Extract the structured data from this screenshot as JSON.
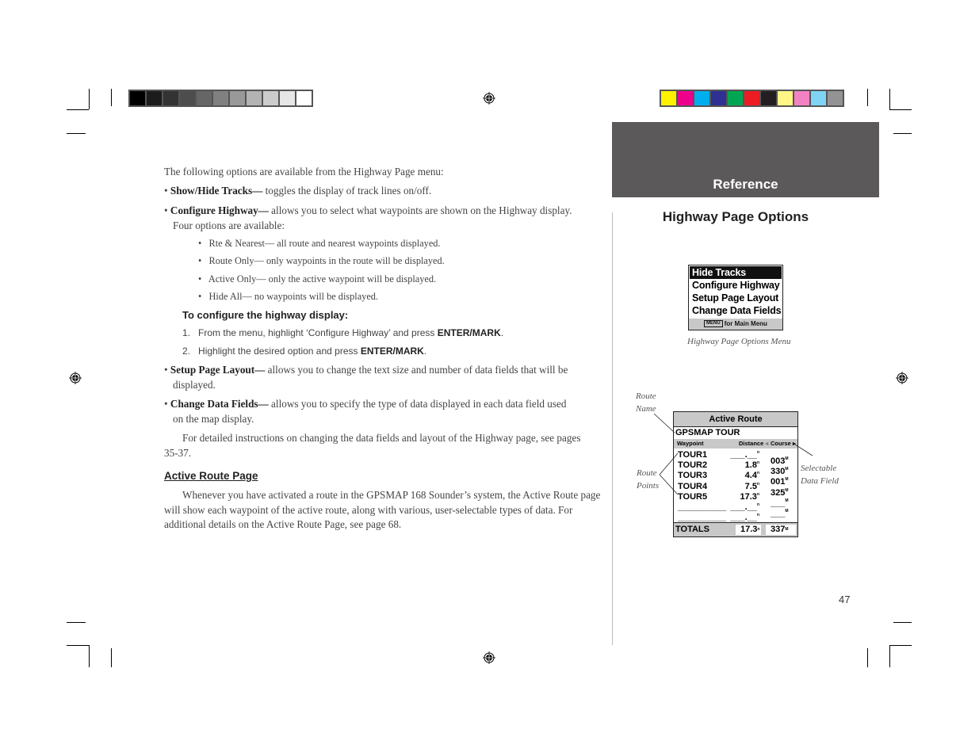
{
  "print_marks": {
    "grayscale_swatches": [
      "#000000",
      "#1c1c1c",
      "#333333",
      "#4d4d4d",
      "#666666",
      "#808080",
      "#999999",
      "#b3b3b3",
      "#cccccc",
      "#e6e6e6",
      "#ffffff"
    ],
    "color_swatches": [
      "#fff200",
      "#ec008c",
      "#00aeef",
      "#2e3192",
      "#00a651",
      "#ed1c24",
      "#231f20",
      "#fff685",
      "#f282c3",
      "#7fd4f5",
      "#939393"
    ]
  },
  "section_tab": {
    "label": "Reference",
    "color": "#5b5959"
  },
  "section_title": "Highway Page Options",
  "intro": "The following options are available from the Highway Page menu:",
  "options": [
    {
      "term": "Show/Hide Tracks—",
      "desc": " toggles the display of track lines on/off."
    },
    {
      "term": "Configure Highway—",
      "desc": " allows you to select what waypoints are shown on the Highway display.",
      "desc_cont": "Four options are available:"
    },
    {
      "term": "Setup Page Layout—",
      "desc": " allows you to change the text size and number of data fields that will be",
      "desc_cont": "displayed."
    },
    {
      "term": "Change Data Fields—",
      "desc": " allows you to specify the type of data displayed in each data field used",
      "desc_cont": "on the map display."
    }
  ],
  "highway_options": [
    "Rte & Nearest— all route and nearest waypoints displayed.",
    "Route Only— only waypoints in the route will be displayed.",
    "Active Only— only the active waypoint will be displayed.",
    "Hide All— no waypoints will be displayed."
  ],
  "procedure": {
    "title": "To configure the highway display:",
    "steps": [
      {
        "num": "1.",
        "text": "From the menu, highlight ‘Configure Highway’ and press ",
        "key": "ENTER/MARK",
        "end": "."
      },
      {
        "num": "2.",
        "text": "Highlight the desired option and press ",
        "key": "ENTER/MARK",
        "end": "."
      }
    ]
  },
  "detail_para": {
    "line1": "For detailed instructions on changing the data fields and layout of the Highway page, see pages",
    "line2": "35-37."
  },
  "active_route": {
    "heading": "Active Route Page",
    "line1": "Whenever you have activated a route in the GPSMAP 168 Sounder’s system, the Active Route page",
    "line2": "will show each waypoint of the active route, along with various, user-selectable types of data.  For",
    "line3": "additional details on the Active Route Page, see page 68."
  },
  "options_menu": {
    "items": [
      "Hide Tracks",
      "Configure Highway",
      "Setup Page Layout",
      "Change Data Fields"
    ],
    "selected_index": 0,
    "footer_key": "MENU",
    "footer_text": "for Main Menu",
    "caption": "Highway Page Options Menu"
  },
  "route_screen": {
    "title": "Active Route",
    "route_name": "GPSMAP TOUR",
    "columns": [
      "Waypoint",
      "Distance",
      "Course"
    ],
    "rows": [
      {
        "waypoint": "TOUR1",
        "distance": "___.__"
      },
      {
        "waypoint": "TOUR2",
        "distance": "1.8"
      },
      {
        "waypoint": "TOUR3",
        "distance": "4.4"
      },
      {
        "waypoint": "TOUR4",
        "distance": "7.5"
      },
      {
        "waypoint": "TOUR5",
        "distance": "17.3"
      },
      {
        "waypoint": "__________",
        "distance": "___.__"
      },
      {
        "waypoint": "__________",
        "distance": "___.__"
      }
    ],
    "courses": [
      "003",
      "330",
      "001",
      "325",
      "___",
      "___"
    ],
    "totals_label": "TOTALS",
    "total_distance": "17.3",
    "total_course": "337"
  },
  "callouts": {
    "route_name": [
      "Route",
      "Name"
    ],
    "route_points": [
      "Route",
      "Points"
    ],
    "selectable_field": [
      "Selectable",
      "Data Field"
    ]
  },
  "page_number": "47"
}
